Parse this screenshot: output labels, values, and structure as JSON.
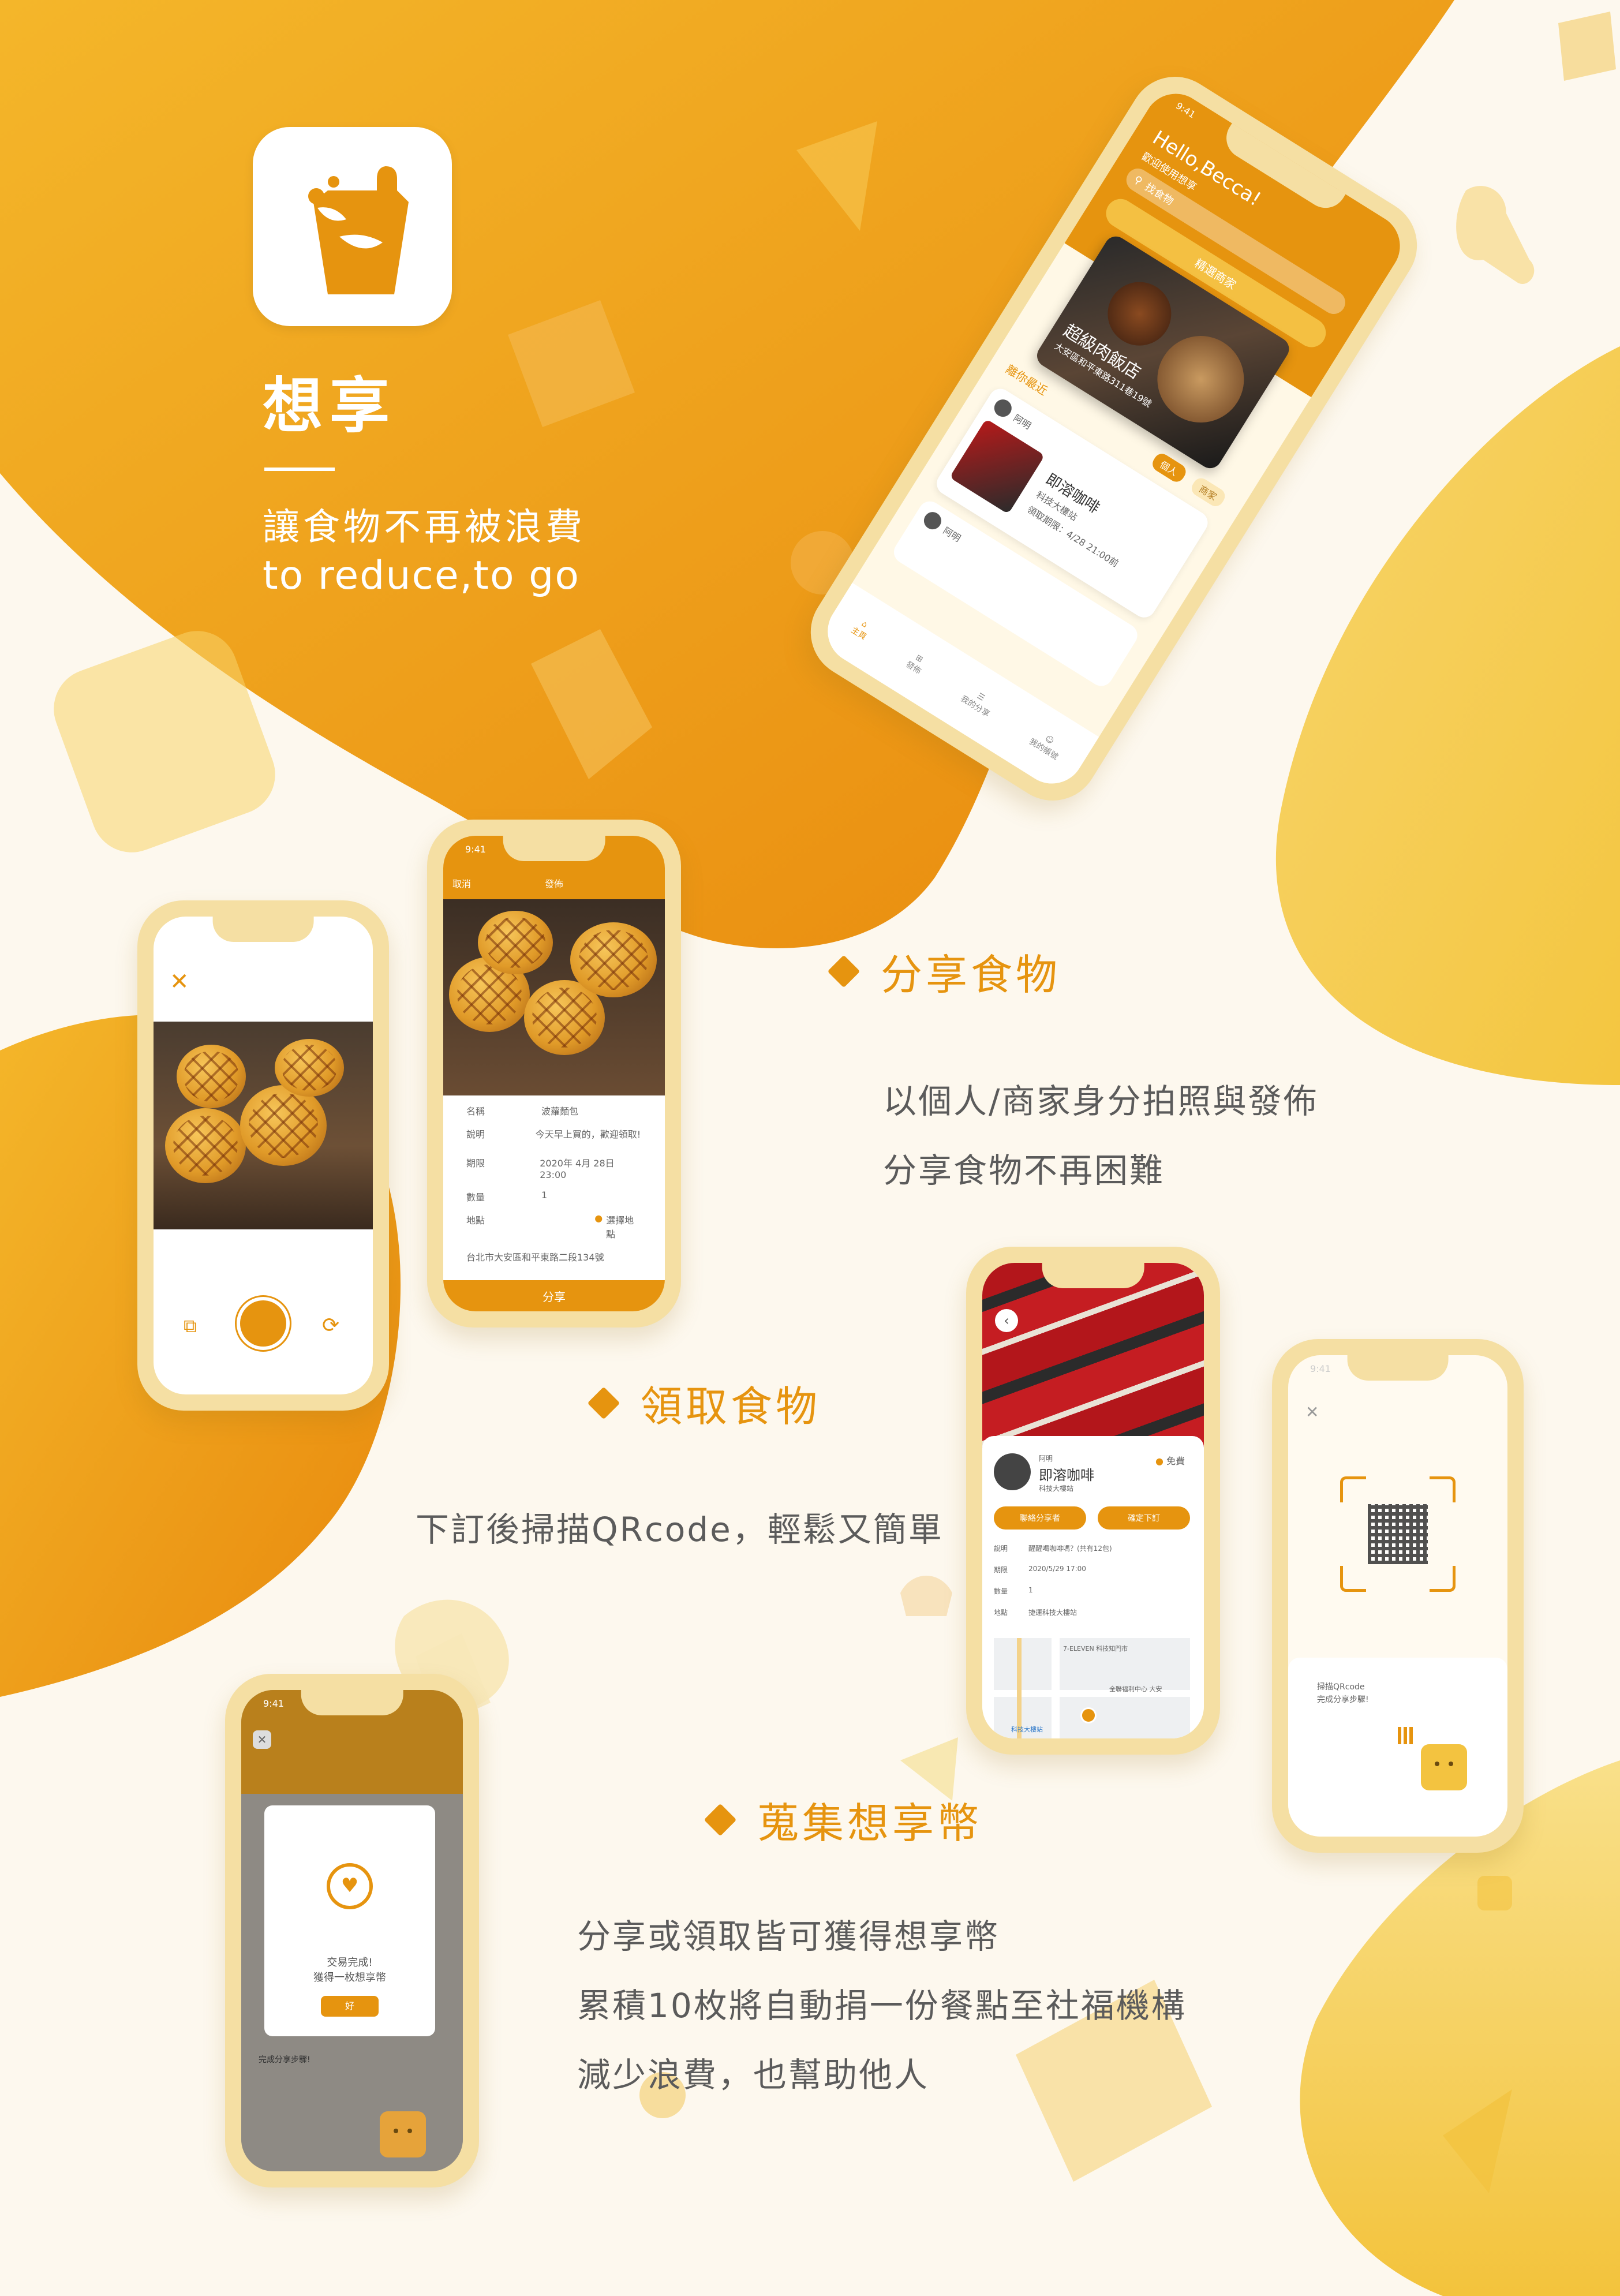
{
  "brand": {
    "name": "想享",
    "slogan": "讓食物不再被浪費",
    "slogan_en": "to reduce,to go"
  },
  "features": [
    {
      "title": "分享食物",
      "lines": [
        "以個人/商家身分拍照與發佈",
        "分享食物不再困難"
      ]
    },
    {
      "title": "領取食物",
      "lines": [
        "下訂後掃描QRcode，輕鬆又簡單"
      ]
    },
    {
      "title": "蒐集想享幣",
      "lines": [
        "分享或領取皆可獲得想享幣",
        "累積10枚將自動捐一份餐點至社福機構",
        "減少浪費，也幫助他人"
      ]
    }
  ],
  "home_screen": {
    "time": "9:41",
    "greeting": "Hello,Becca!",
    "welcome": "歡迎使用想享",
    "search_placeholder": "找食物",
    "featured_label": "精選商家",
    "store_name": "超級肉飯店",
    "store_address": "大安區和平東路311巷19號",
    "nearby_label": "離你最近",
    "filter_personal": "個人",
    "filter_store": "商家",
    "card1_user": "阿明",
    "card1_item": "即溶咖啡",
    "card1_place": "科技大樓站",
    "card1_deadline": "領取期限：4/28 21:00前",
    "card2_user": "阿明",
    "nav": [
      "主頁",
      "發佈",
      "我的分享",
      "我的帳號"
    ]
  },
  "camera_screen": {},
  "publish_screen": {
    "time": "9:41",
    "cancel": "取消",
    "title": "發佈",
    "rows": [
      {
        "label": "名稱",
        "value": "波蘿麵包"
      },
      {
        "label": "說明",
        "value": "今天早上買的，歡迎領取!"
      },
      {
        "label": "期限",
        "value": "2020年 4月 28日 23:00"
      },
      {
        "label": "數量",
        "value": "1"
      },
      {
        "label": "地點",
        "value": "選擇地點"
      }
    ],
    "address": "台北市大安區和平東路二段134號",
    "submit": "分享"
  },
  "detail_screen": {
    "user_label": "阿明",
    "item": "即溶咖啡",
    "place": "科技大樓站",
    "price": "免費",
    "btn_message": "聯絡分享者",
    "btn_order": "確定下訂",
    "rows": [
      {
        "label": "說明",
        "value": "醒醒喝咖啡嗎？(共有12包)"
      },
      {
        "label": "期限",
        "value": "2020/5/29 17:00"
      },
      {
        "label": "數量",
        "value": "1"
      },
      {
        "label": "地點",
        "value": "捷運科技大樓站"
      }
    ],
    "map_labels": [
      "7-ELEVEN 科技知門市",
      "全聯福利中心 大安",
      "科技大樓站"
    ]
  },
  "qr_screen": {
    "time": "9:41",
    "hint1": "掃描QRcode",
    "hint2": "完成分享步驟!"
  },
  "success_screen": {
    "time": "9:41",
    "msg1": "交易完成!",
    "msg2": "獲得一枚想享幣",
    "ok": "好",
    "footer": "完成分享步驟!"
  },
  "colors": {
    "accent": "#e6940f",
    "light": "#f5dfa3",
    "bg": "#fdf8ee"
  }
}
